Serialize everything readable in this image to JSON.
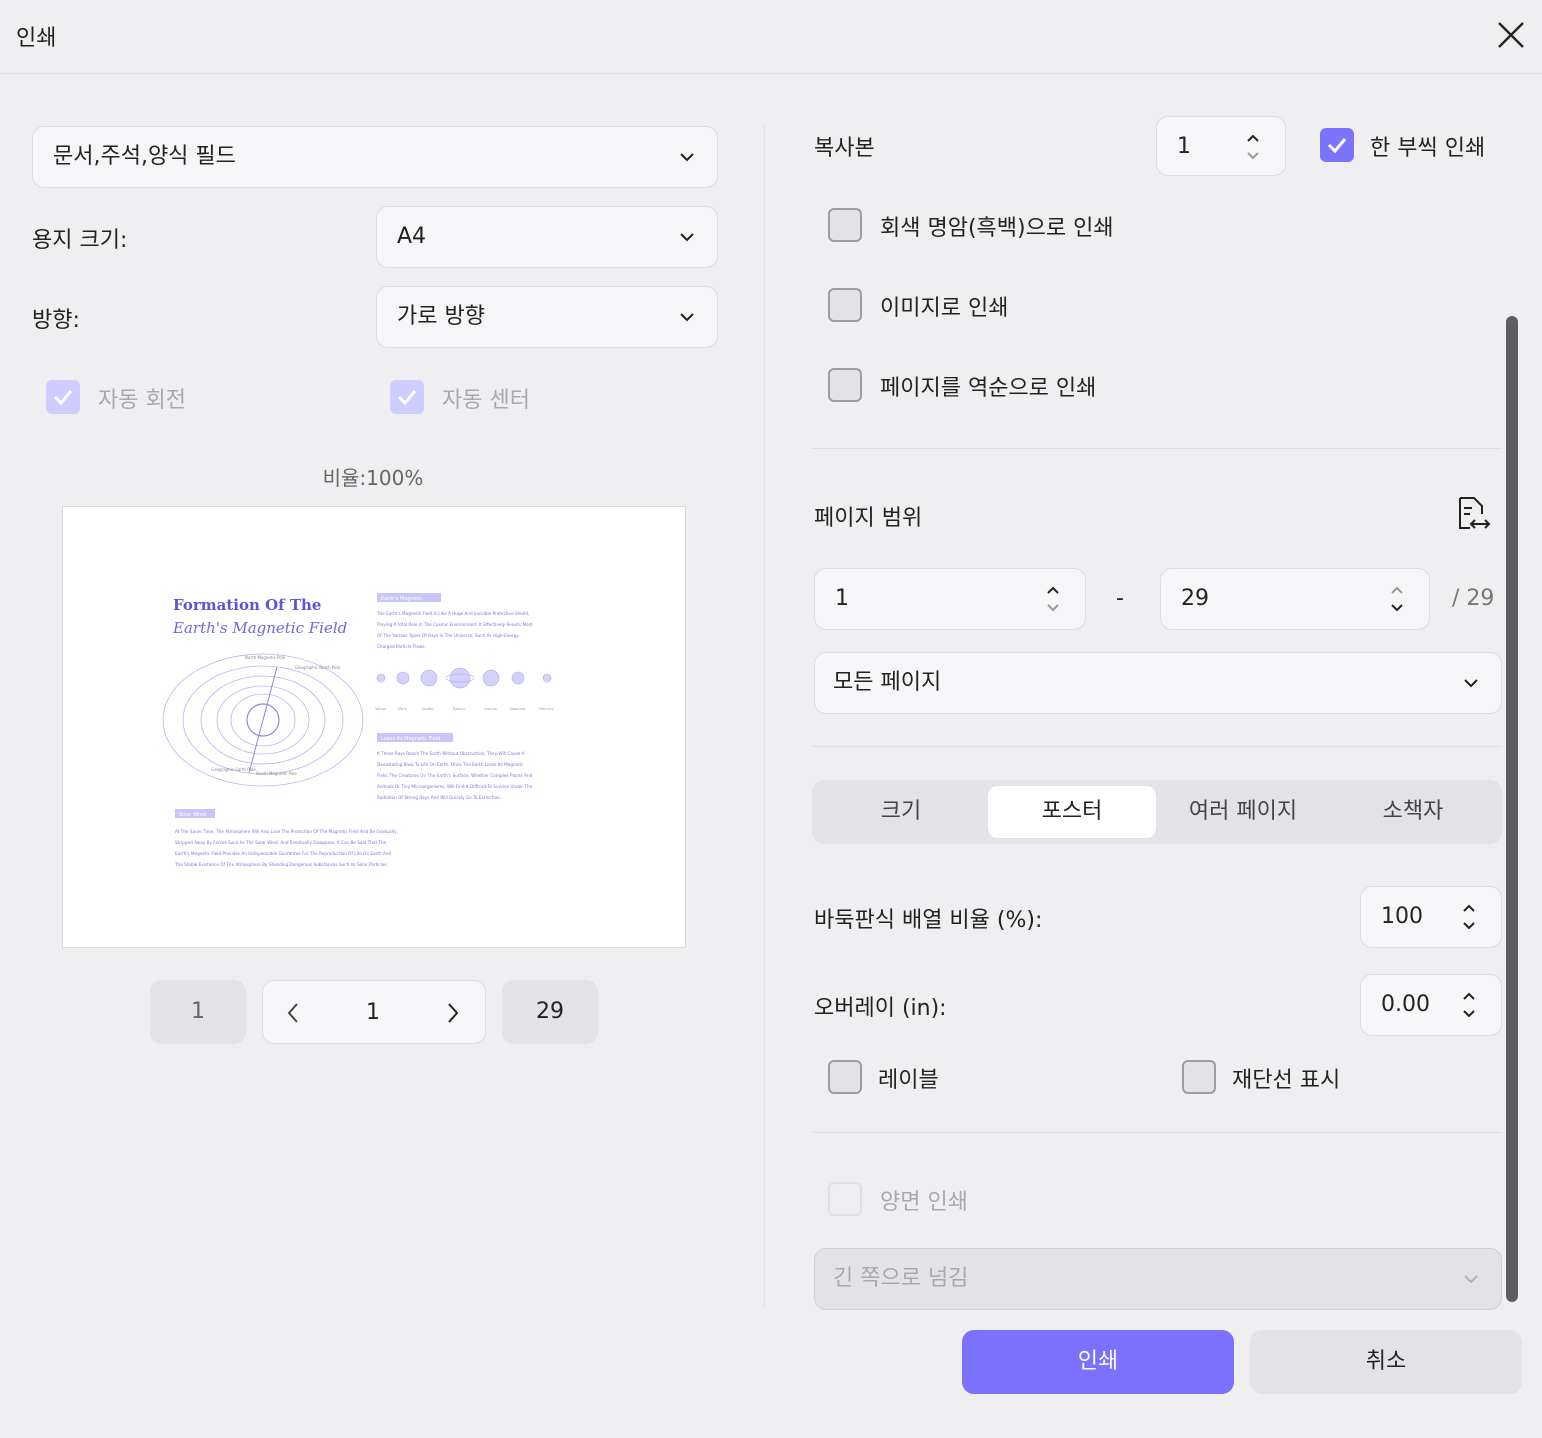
{
  "window": {
    "title": "인쇄"
  },
  "left": {
    "content_select": "문서,주석,양식 필드",
    "paper_size_label": "용지 크기:",
    "paper_size_value": "A4",
    "orientation_label": "방향:",
    "orientation_value": "가로 방향",
    "auto_rotate_label": "자동 회전",
    "auto_center_label": "자동 센터",
    "scale_label": "비율:100%",
    "pager": {
      "first": "1",
      "current": "1",
      "last": "29"
    }
  },
  "preview_doc": {
    "title_line1": "Formation Of The",
    "title_line2": "Earth's Magnetic Field",
    "tag1": "Earth's Magnetic",
    "text1": [
      "The Earth's Magnetic Field Is Like A Huge And Invisible Protective Shield,",
      "Playing A Vital Role In The Cosmic Environment. It Effectively Resists Most",
      "Of The Various Types Of Rays In The Universe, Such As High-Energy",
      "Charged Particle Flows."
    ],
    "planets": [
      "Venus",
      "Mars",
      "Jupiter",
      "Saturn",
      "Uranus",
      "Neptune",
      "Mercury"
    ],
    "tag2": "Loses Its Magnetic Field",
    "text2": [
      "If These Rays Reach The Earth Without Obstruction, They Will Cause A",
      "Devastating Blow To Life On Earth. Once The Earth Loses Its Magnetic",
      "Field, The Creatures On The Earth's Surface, Whether Complex Plants And",
      "Animals Or Tiny Microorganisms, Will Find It Difficult To Survive Under The",
      "Radiation Of Strong Rays And Will Quickly Go To Extinction."
    ],
    "tag3": "Solar Wind",
    "text3": [
      "At The Same Time, The Atmosphere Will Also Lose The Protection Of The Magnetic Field And Be Gradually",
      "Stripped Away By Forces Such As The Solar Wind, And Eventually Disappear. It Can Be Said That The",
      "Earth's Magnetic Field Provides An Indispensable Guarantee For The Reproduction Of Life On Earth And",
      "The Stable Existence Of The Atmosphere By Shielding Dangerous Substances Such As Solar Particles."
    ],
    "diagram_labels": {
      "north_mag": "North Magnetic Pole",
      "geo_north": "Geographic North Pole",
      "geo_south": "Geographic Earth Pole",
      "south_mag": "South Magnetic Pole"
    }
  },
  "right": {
    "copies_label": "복사본",
    "copies_value": "1",
    "collate_label": "한 부씩 인쇄",
    "grayscale_label": "회색 명암(흑백)으로 인쇄",
    "as_image_label": "이미지로 인쇄",
    "reverse_label": "페이지를 역순으로 인쇄",
    "range_title": "페이지 범위",
    "range_from": "1",
    "range_dash": "-",
    "range_to": "29",
    "range_total": "/ 29",
    "range_select": "모든 페이지",
    "tabs": [
      "크기",
      "포스터",
      "여러 페이지",
      "소책자"
    ],
    "tile_scale_label": "바둑판식 배열 비율 (%):",
    "tile_scale_value": "100",
    "overlay_label": "오버레이 (in):",
    "overlay_value": "0.00",
    "labels_label": "레이블",
    "cut_marks_label": "재단선 표시",
    "duplex_label": "양면 인쇄",
    "flip_select": "긴 쪽으로 넘김"
  },
  "buttons": {
    "print": "인쇄",
    "cancel": "취소"
  },
  "colors": {
    "accent": "#7a71ff",
    "background": "#efeff1"
  }
}
